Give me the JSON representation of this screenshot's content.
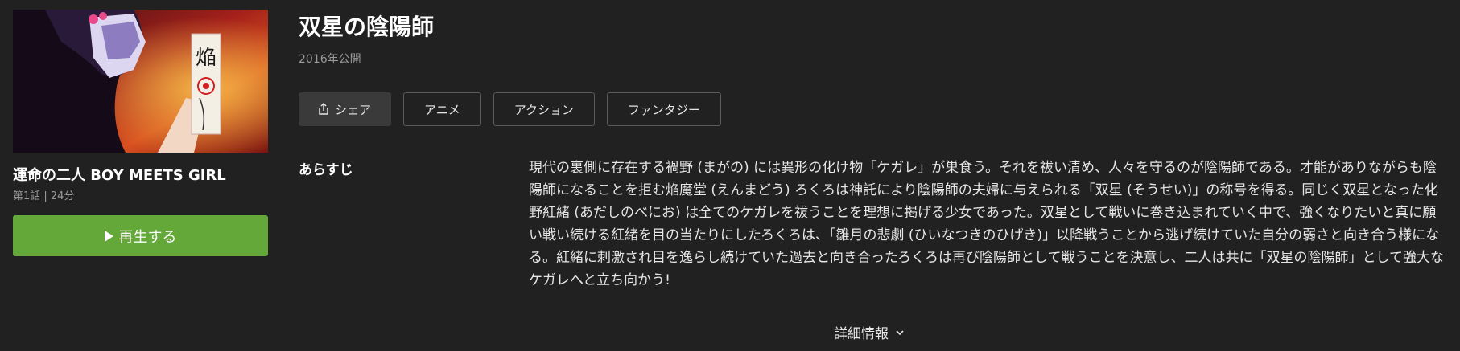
{
  "episode": {
    "title": "運命の二人 BOY MEETS GIRL",
    "meta": "第1話 | 24分",
    "play_label": "再生する",
    "thumbnail_sign_text": "焔"
  },
  "show": {
    "title": "双星の陰陽師",
    "year": "2016年公開"
  },
  "tags": [
    {
      "label": "シェア",
      "icon": "share-icon"
    },
    {
      "label": "アニメ"
    },
    {
      "label": "アクション"
    },
    {
      "label": "ファンタジー"
    }
  ],
  "synopsis": {
    "label": "あらすじ",
    "text": "現代の裏側に存在する禍野 (まがの) には異形の化け物「ケガレ」が巣食う。それを祓い清め、人々を守るのが陰陽師である。才能がありながらも陰陽師になることを拒む焔魔堂 (えんまどう) ろくろは神託により陰陽師の夫婦に与えられる「双星 (そうせい)」の称号を得る。同じく双星となった化野紅緒 (あだしのべにお) は全てのケガレを祓うことを理想に掲げる少女であった。双星として戦いに巻き込まれていく中で、強くなりたいと真に願い戦い続ける紅緒を目の当たりにしたろくろは、「雛月の悲劇 (ひいなつきのひげき)」以降戦うことから逃げ続けていた自分の弱さと向き合う様になる。紅緒に刺激され目を逸らし続けていた過去と向き合ったろくろは再び陰陽師として戦うことを決意し、二人は共に「双星の陰陽師」として強大なケガレへと立ち向かう!"
  },
  "details_label": "詳細情報",
  "colors": {
    "background": "#212121",
    "play_button": "#64a839",
    "share_button": "#3a3a3a"
  }
}
